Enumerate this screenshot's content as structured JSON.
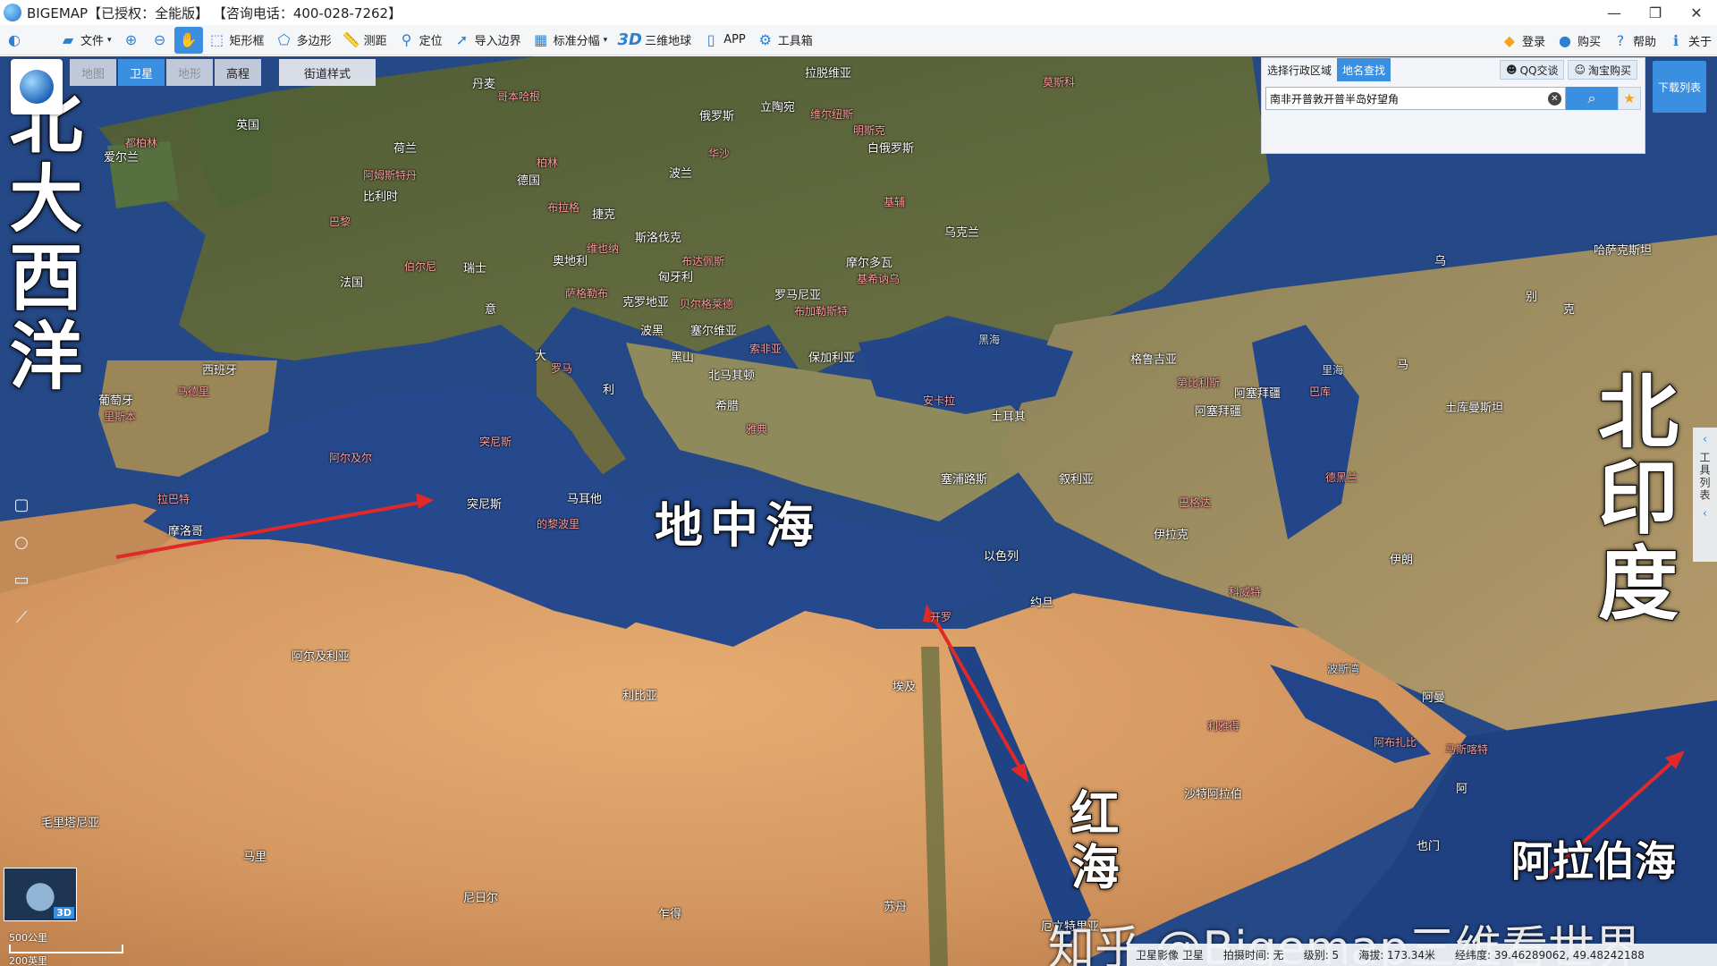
{
  "window": {
    "title": "BIGEMAP【已授权：全能版】 【咨询电话：400-028-7262】",
    "controls": [
      "—",
      "❐",
      "✕"
    ]
  },
  "toolbar": {
    "items": [
      {
        "label": "文件",
        "icon": "folder-icon"
      },
      {
        "label": "",
        "icon": "zoom-in-icon"
      },
      {
        "label": "",
        "icon": "zoom-out-icon"
      },
      {
        "label": "",
        "icon": "pan-hand-icon"
      },
      {
        "label": "矩形框",
        "icon": "rectangle-select-icon"
      },
      {
        "label": "多边形",
        "icon": "polygon-select-icon"
      },
      {
        "label": "测距",
        "icon": "ruler-icon"
      },
      {
        "label": "定位",
        "icon": "locate-pin-icon"
      },
      {
        "label": "导入边界",
        "icon": "import-boundary-icon"
      },
      {
        "label": "标准分幅",
        "icon": "grid-icon"
      },
      {
        "label": "三维地球",
        "icon": "3d-icon"
      },
      {
        "label": "APP",
        "icon": "phone-download-icon"
      },
      {
        "label": "工具箱",
        "icon": "gear-icon"
      }
    ],
    "right": [
      {
        "label": "登录",
        "icon": "login-icon"
      },
      {
        "label": "购买",
        "icon": "buy-icon"
      },
      {
        "label": "帮助",
        "icon": "help-icon"
      },
      {
        "label": "关于",
        "icon": "info-icon"
      }
    ]
  },
  "map_tabs": [
    "地图",
    "卫星",
    "地形",
    "高程"
  ],
  "street_style": "街道样式",
  "search_panel": {
    "tabs": [
      "选择行政区域",
      "地名查找"
    ],
    "links": [
      "QQ交谈",
      "淘宝购买"
    ],
    "value": "南非开普敦开普半岛好望角"
  },
  "download_list": "下载列表",
  "right_rail": "工具列表",
  "big_labels": {
    "north_atlantic": "北大西洋",
    "mediterranean": "地中海",
    "north_india": "北印度",
    "red_sea": "红海",
    "arabian_sea": "阿拉伯海"
  },
  "map_labels": [
    {
      "text": "丹麦",
      "cls": ""
    },
    {
      "text": "哥本哈根",
      "cls": "cap"
    },
    {
      "text": "拉脱维亚",
      "cls": ""
    },
    {
      "text": "莫斯科",
      "cls": "cap"
    },
    {
      "text": "立陶宛",
      "cls": ""
    },
    {
      "text": "维尔纽斯",
      "cls": "cap"
    },
    {
      "text": "俄罗斯",
      "cls": ""
    },
    {
      "text": "明斯克",
      "cls": "cap"
    },
    {
      "text": "白俄罗斯",
      "cls": ""
    },
    {
      "text": "英国",
      "cls": ""
    },
    {
      "text": "都柏林",
      "cls": "cap"
    },
    {
      "text": "爱尔兰",
      "cls": ""
    },
    {
      "text": "荷兰",
      "cls": ""
    },
    {
      "text": "柏林",
      "cls": "cap"
    },
    {
      "text": "华沙",
      "cls": "cap"
    },
    {
      "text": "阿姆斯特丹",
      "cls": "cap"
    },
    {
      "text": "德国",
      "cls": ""
    },
    {
      "text": "波兰",
      "cls": ""
    },
    {
      "text": "比利时",
      "cls": ""
    },
    {
      "text": "布拉格",
      "cls": "cap"
    },
    {
      "text": "捷克",
      "cls": ""
    },
    {
      "text": "基辅",
      "cls": "cap"
    },
    {
      "text": "乌克兰",
      "cls": ""
    },
    {
      "text": "巴黎",
      "cls": "cap"
    },
    {
      "text": "维也纳",
      "cls": "cap"
    },
    {
      "text": "斯洛伐克",
      "cls": ""
    },
    {
      "text": "奥地利",
      "cls": ""
    },
    {
      "text": "布达佩斯",
      "cls": "cap"
    },
    {
      "text": "匈牙利",
      "cls": ""
    },
    {
      "text": "摩尔多瓦",
      "cls": ""
    },
    {
      "text": "基希讷乌",
      "cls": "cap"
    },
    {
      "text": "哈萨克斯坦",
      "cls": ""
    },
    {
      "text": "伯尔尼",
      "cls": "cap"
    },
    {
      "text": "瑞士",
      "cls": ""
    },
    {
      "text": "法国",
      "cls": ""
    },
    {
      "text": "萨格勒布",
      "cls": "cap"
    },
    {
      "text": "克罗地亚",
      "cls": ""
    },
    {
      "text": "贝尔格莱德",
      "cls": "cap"
    },
    {
      "text": "罗马尼亚",
      "cls": ""
    },
    {
      "text": "布加勒斯特",
      "cls": "cap"
    },
    {
      "text": "意",
      "cls": ""
    },
    {
      "text": "波黑",
      "cls": ""
    },
    {
      "text": "塞尔维亚",
      "cls": ""
    },
    {
      "text": "黑海",
      "cls": "sea"
    },
    {
      "text": "索非亚",
      "cls": "cap"
    },
    {
      "text": "黑山",
      "cls": ""
    },
    {
      "text": "保加利亚",
      "cls": ""
    },
    {
      "text": "格鲁吉亚",
      "cls": ""
    },
    {
      "text": "西班牙",
      "cls": ""
    },
    {
      "text": "大",
      "cls": ""
    },
    {
      "text": "罗马",
      "cls": "cap"
    },
    {
      "text": "北马其顿",
      "cls": ""
    },
    {
      "text": "第比利斯",
      "cls": "cap"
    },
    {
      "text": "里海",
      "cls": "sea"
    },
    {
      "text": "马德里",
      "cls": "cap"
    },
    {
      "text": "利",
      "cls": ""
    },
    {
      "text": "阿塞拜疆",
      "cls": ""
    },
    {
      "text": "巴库",
      "cls": "cap"
    },
    {
      "text": "葡萄牙",
      "cls": ""
    },
    {
      "text": "希腊",
      "cls": ""
    },
    {
      "text": "安卡拉",
      "cls": "cap"
    },
    {
      "text": "里斯本",
      "cls": "cap"
    },
    {
      "text": "土耳其",
      "cls": ""
    },
    {
      "text": "阿塞拜疆",
      "cls": ""
    },
    {
      "text": "土库曼斯坦",
      "cls": ""
    },
    {
      "text": "阿尔及尔",
      "cls": "cap"
    },
    {
      "text": "突尼斯",
      "cls": "cap"
    },
    {
      "text": "雅典",
      "cls": "cap"
    },
    {
      "text": "马耳他",
      "cls": ""
    },
    {
      "text": "塞浦路斯",
      "cls": ""
    },
    {
      "text": "德黑兰",
      "cls": "cap"
    },
    {
      "text": "拉巴特",
      "cls": "cap"
    },
    {
      "text": "叙利亚",
      "cls": ""
    },
    {
      "text": "突尼斯",
      "cls": ""
    },
    {
      "text": "巴格达",
      "cls": "cap"
    },
    {
      "text": "伊朗",
      "cls": ""
    },
    {
      "text": "摩洛哥",
      "cls": ""
    },
    {
      "text": "的黎波里",
      "cls": "cap"
    },
    {
      "text": "伊拉克",
      "cls": ""
    },
    {
      "text": "以色列",
      "cls": ""
    },
    {
      "text": "开罗",
      "cls": "cap"
    },
    {
      "text": "约旦",
      "cls": ""
    },
    {
      "text": "科威特",
      "cls": "cap"
    },
    {
      "text": "波斯湾",
      "cls": "sea"
    },
    {
      "text": "阿尔及利亚",
      "cls": ""
    },
    {
      "text": "利比亚",
      "cls": ""
    },
    {
      "text": "阿曼",
      "cls": ""
    },
    {
      "text": "埃及",
      "cls": ""
    },
    {
      "text": "利雅得",
      "cls": "cap"
    },
    {
      "text": "阿布扎比",
      "cls": "cap"
    },
    {
      "text": "马斯喀特",
      "cls": "cap"
    },
    {
      "text": "阿",
      "cls": ""
    },
    {
      "text": "沙特阿拉伯",
      "cls": ""
    },
    {
      "text": "毛里塔尼亚",
      "cls": ""
    },
    {
      "text": "马里",
      "cls": ""
    },
    {
      "text": "也门",
      "cls": ""
    },
    {
      "text": "尼日尔",
      "cls": ""
    },
    {
      "text": "乍得",
      "cls": ""
    },
    {
      "text": "苏丹",
      "cls": ""
    },
    {
      "text": "厄立特里亚",
      "cls": ""
    },
    {
      "text": "马",
      "cls": ""
    },
    {
      "text": "别",
      "cls": ""
    },
    {
      "text": "克",
      "cls": ""
    },
    {
      "text": "乌",
      "cls": ""
    }
  ],
  "statusbar": {
    "imagery": "卫星影像 卫星",
    "capture": "拍摄时间: 无",
    "level": "级别: 5",
    "elevation": "海拔: 173.34米",
    "coords": "经纬度: 39.46289062, 49.48242188"
  },
  "scale": {
    "km": "500公里",
    "mi": "200英里"
  },
  "minimap_tag": "3D",
  "watermark": "知乎 @Bigemap三维看世界",
  "colors": {
    "accent": "#3b8fe0",
    "sea": "#2a4c8e",
    "desert": "#d8a06a",
    "land_green": "#5f6b3c",
    "arrow": "#e02a2a"
  }
}
